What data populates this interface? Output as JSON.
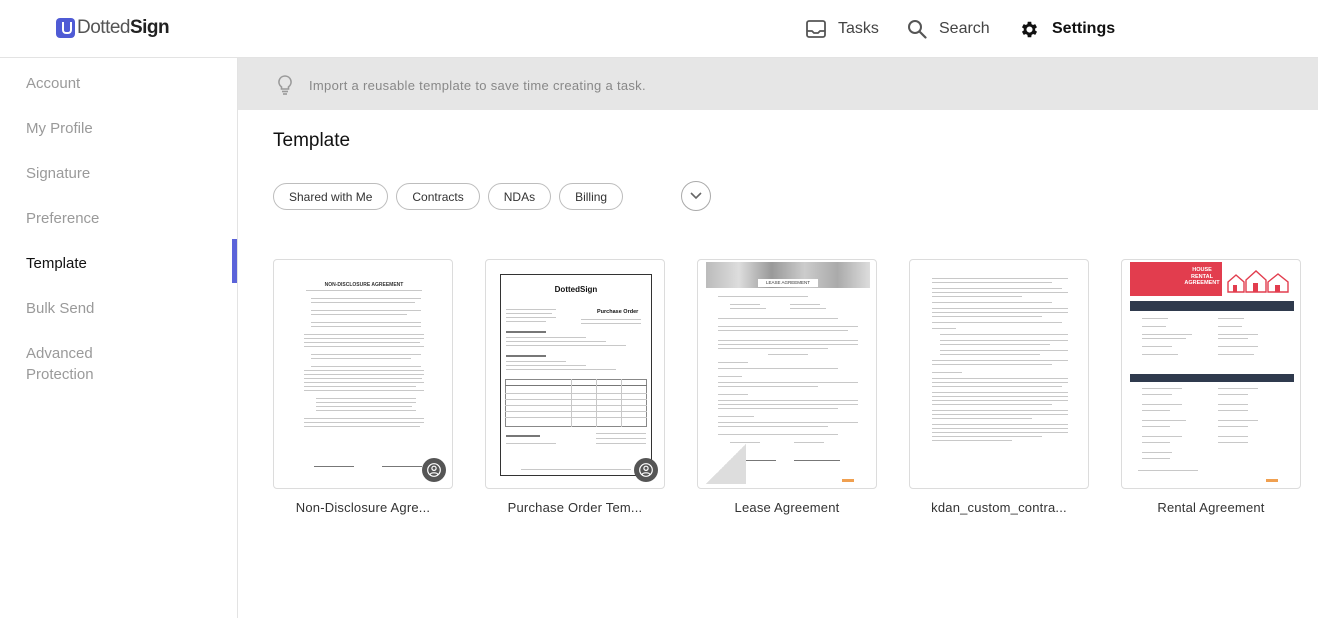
{
  "brand": {
    "logo_light": "Dotted",
    "logo_bold": "Sign",
    "accent_color": "#5b63d9"
  },
  "header": {
    "nav": [
      {
        "label": "Tasks",
        "icon": "inbox-icon"
      },
      {
        "label": "Search",
        "icon": "search-icon"
      },
      {
        "label": "Settings",
        "icon": "gear-icon",
        "active": true
      }
    ]
  },
  "sidebar": {
    "items": [
      {
        "label": "Account"
      },
      {
        "label": "My Profile"
      },
      {
        "label": "Signature"
      },
      {
        "label": "Preference"
      },
      {
        "label": "Template",
        "active": true
      },
      {
        "label": "Bulk Send"
      },
      {
        "label": "Advanced Protection"
      }
    ]
  },
  "banner": {
    "icon": "lightbulb-icon",
    "text": "Import a reusable template to save time creating a task."
  },
  "main": {
    "title": "Template",
    "filters": [
      "Shared with Me",
      "Contracts",
      "NDAs",
      "Billing"
    ],
    "expand_icon": "chevron-down-icon",
    "templates": [
      {
        "label": "Non-Disclosure Agre...",
        "doc_heading": "NON-DISCLOSURE AGREEMENT",
        "shared": true
      },
      {
        "label": "Purchase Order Tem...",
        "doc_brand": "DottedSign",
        "doc_heading": "Purchase Order",
        "shared": true
      },
      {
        "label": "Lease Agreement",
        "doc_heading": "LEASE AGREEMENT",
        "shared": false
      },
      {
        "label": "kdan_custom_contra...",
        "shared": false
      },
      {
        "label": "Rental Agreement",
        "doc_heading": "HOUSE RENTAL AGREEMENT",
        "shared": false
      }
    ]
  }
}
